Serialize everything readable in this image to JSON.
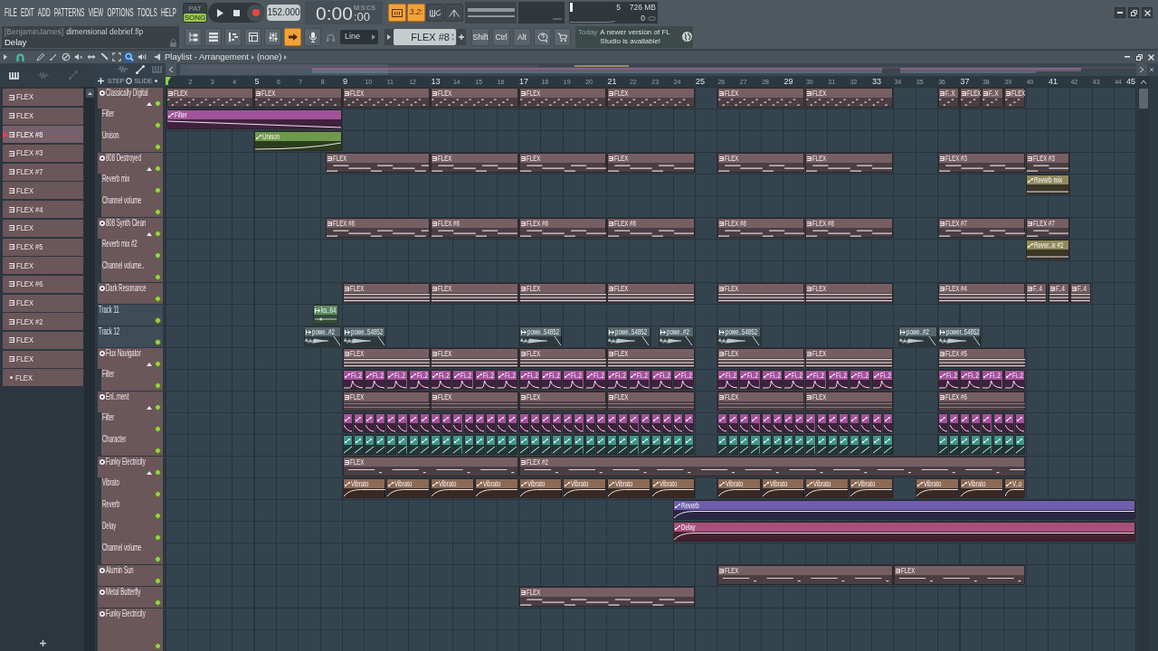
{
  "menu": [
    "FILE",
    "EDIT",
    "ADD",
    "PATTERNS",
    "VIEW",
    "OPTIONS",
    "TOOLS",
    "HELP"
  ],
  "modes": [
    {
      "label": "PAT",
      "selected": false
    },
    {
      "label": "SONG",
      "selected": true
    }
  ],
  "tempo": "152.000",
  "time": {
    "main": "0:00",
    "fraction": ":00",
    "format": "M:S:CS"
  },
  "record_options": [
    {
      "kind": "typing",
      "on": true
    },
    {
      "kind": "countdown",
      "label": "3.2:",
      "on": true
    },
    {
      "kind": "loop",
      "on": false
    },
    {
      "kind": "blend",
      "on": false
    }
  ],
  "performance": {
    "cpu": "5",
    "memory": "726 MB",
    "voices": "0"
  },
  "hint_bar": {
    "user": "[BenjaminJames]",
    "file": "dimensional debrief.flp",
    "hint": "Delay"
  },
  "view_buttons": [
    {
      "kind": "browser",
      "on": false
    },
    {
      "kind": "rack",
      "on": false
    },
    {
      "kind": "piano",
      "on": false
    },
    {
      "kind": "playlist",
      "on": false
    },
    {
      "kind": "mixer",
      "on": false
    },
    {
      "kind": "arrow",
      "on": true
    },
    {
      "kind": "mic",
      "on": false
    }
  ],
  "snap": "Line",
  "pattern": "FLEX #8",
  "modifier_keys": [
    "Shift",
    "Ctrl",
    "Alt"
  ],
  "news": {
    "date": "Today",
    "message": "A newer version of FL Studio is available!"
  },
  "playlist": {
    "title": "Playlist - Arrangement",
    "arrangement": "(none)",
    "tools": [
      {
        "kind": "pencil",
        "selected": false
      },
      {
        "kind": "brush",
        "selected": false
      },
      {
        "kind": "delete",
        "selected": false
      },
      {
        "kind": "mute",
        "selected": false
      },
      {
        "kind": "slip",
        "selected": false
      },
      {
        "kind": "slice",
        "selected": false
      },
      {
        "kind": "select",
        "selected": false
      },
      {
        "kind": "zoom",
        "selected": true
      },
      {
        "kind": "playback",
        "selected": false
      }
    ],
    "picker_tabs": [
      {
        "kind": "pattern",
        "selected": true
      },
      {
        "kind": "audio",
        "selected": false
      },
      {
        "kind": "automation",
        "selected": false
      }
    ],
    "picker": [
      {
        "label": "FLEX",
        "kind": "pattern",
        "selected": false
      },
      {
        "label": "FLEX",
        "kind": "pattern",
        "selected": false
      },
      {
        "label": "FLEX #8",
        "kind": "pattern",
        "selected": true
      },
      {
        "label": "FLEX #3",
        "kind": "pattern",
        "selected": false
      },
      {
        "label": "FLEX #7",
        "kind": "pattern",
        "selected": false
      },
      {
        "label": "FLEX",
        "kind": "pattern",
        "selected": false
      },
      {
        "label": "FLEX #4",
        "kind": "pattern",
        "selected": false
      },
      {
        "label": "FLEX",
        "kind": "pattern",
        "selected": false
      },
      {
        "label": "FLEX #5",
        "kind": "pattern",
        "selected": false
      },
      {
        "label": "FLEX",
        "kind": "pattern",
        "selected": false
      },
      {
        "label": "FLEX #6",
        "kind": "pattern",
        "selected": false
      },
      {
        "label": "FLEX",
        "kind": "pattern",
        "selected": false
      },
      {
        "label": "FLEX #2",
        "kind": "pattern",
        "selected": false
      },
      {
        "label": "FLEX",
        "kind": "pattern",
        "selected": false
      },
      {
        "label": "FLEX",
        "kind": "pattern",
        "selected": false
      },
      {
        "label": "FLEX",
        "kind": "audio",
        "selected": false
      }
    ],
    "lane_options": [
      "STEP",
      "SLIDE"
    ],
    "ruler": [
      "2",
      "3",
      "4",
      "5",
      "6",
      "7",
      "8",
      "9",
      "10",
      "11",
      "12",
      "13",
      "14",
      "15",
      "16",
      "17",
      "18",
      "19",
      "20",
      "21",
      "22",
      "23",
      "24",
      "25",
      "26",
      "27",
      "28",
      "29",
      "30",
      "31",
      "32",
      "33",
      "34",
      "35",
      "36",
      "37",
      "38",
      "39",
      "40",
      "41",
      "42",
      "43",
      "44",
      "45"
    ],
    "tracks": [
      {
        "name": "Classically Digital",
        "kind": "instrument",
        "enabled": true,
        "expanded": true,
        "clips": [
          {
            "label": "FLEX",
            "kind": "pattern"
          },
          {
            "label": "FLEX",
            "kind": "pattern"
          },
          {
            "label": "FLEX",
            "kind": "pattern"
          },
          {
            "label": "FLEX",
            "kind": "pattern"
          },
          {
            "label": "FLEX",
            "kind": "pattern"
          },
          {
            "label": "FLEX",
            "kind": "pattern"
          },
          {
            "label": "FLEX",
            "kind": "pattern"
          },
          {
            "label": "FLEX",
            "kind": "pattern"
          },
          {
            "label": "F..X",
            "kind": "pattern"
          },
          {
            "label": "FLEX",
            "kind": "pattern"
          },
          {
            "label": "F..X",
            "kind": "pattern"
          },
          {
            "label": "FLEX",
            "kind": "pattern"
          }
        ],
        "children": [
          {
            "name": "Filter",
            "enabled": true,
            "clips": [
              {
                "label": "Filter",
                "kind": "automation",
                "color": "#a3529c"
              }
            ]
          },
          {
            "name": "Unison",
            "enabled": true,
            "clips": [
              {
                "label": "Unison",
                "kind": "automation",
                "color": "#6e9a4c"
              }
            ]
          }
        ]
      },
      {
        "name": "808 Destroyed",
        "kind": "instrument",
        "enabled": true,
        "expanded": true,
        "clips": [
          {
            "label": "FLEX",
            "kind": "pattern"
          },
          {
            "label": "FLEX",
            "kind": "pattern"
          },
          {
            "label": "FLEX",
            "kind": "pattern"
          },
          {
            "label": "FLEX",
            "kind": "pattern"
          },
          {
            "label": "FLEX",
            "kind": "pattern"
          },
          {
            "label": "FLEX",
            "kind": "pattern"
          },
          {
            "label": "FLEX #3",
            "kind": "pattern"
          },
          {
            "label": "FLEX #3",
            "kind": "pattern"
          }
        ],
        "children": [
          {
            "name": "Reverb mix",
            "enabled": true,
            "clips": [
              {
                "label": "Reverb mix",
                "kind": "automation",
                "color": "#8f8b5c"
              }
            ]
          },
          {
            "name": "Channel volume",
            "enabled": true
          }
        ]
      },
      {
        "name": "808 Synth Clean",
        "kind": "instrument",
        "enabled": true,
        "expanded": true,
        "clips": [
          {
            "label": "FLEX #8",
            "kind": "pattern"
          },
          {
            "label": "FLEX #8",
            "kind": "pattern"
          },
          {
            "label": "FLEX #8",
            "kind": "pattern"
          },
          {
            "label": "FLEX #8",
            "kind": "pattern"
          },
          {
            "label": "FLEX #8",
            "kind": "pattern"
          },
          {
            "label": "FLEX #8",
            "kind": "pattern"
          },
          {
            "label": "FLEX #7",
            "kind": "pattern"
          },
          {
            "label": "FLEX #7",
            "kind": "pattern"
          }
        ],
        "children": [
          {
            "name": "Reverb mix #2",
            "enabled": true,
            "clips": [
              {
                "label": "Rever..ix #2",
                "kind": "automation",
                "color": "#8f8b5c"
              }
            ]
          },
          {
            "name": "Channel volume..",
            "enabled": true
          }
        ]
      },
      {
        "name": "Dark Resonance",
        "kind": "instrument",
        "enabled": true,
        "clips": [
          {
            "label": "FLEX",
            "kind": "pattern"
          },
          {
            "label": "FLEX",
            "kind": "pattern"
          },
          {
            "label": "FLEX",
            "kind": "pattern"
          },
          {
            "label": "FLEX",
            "kind": "pattern"
          },
          {
            "label": "FLEX",
            "kind": "pattern"
          },
          {
            "label": "FLEX",
            "kind": "pattern"
          },
          {
            "label": "FLEX #4",
            "kind": "pattern"
          },
          {
            "label": "F..4",
            "kind": "pattern"
          },
          {
            "label": "F..4",
            "kind": "pattern"
          },
          {
            "label": "F..4",
            "kind": "pattern"
          }
        ]
      },
      {
        "name": "Track 11",
        "kind": "plain",
        "enabled": true,
        "clips": [
          {
            "label": "ks..64",
            "kind": "audio",
            "color": "#5d8a64"
          }
        ]
      },
      {
        "name": "Track 12",
        "kind": "plain",
        "enabled": true,
        "clips": [
          {
            "label": "powe..#2",
            "kind": "audio",
            "color": "#55676c"
          },
          {
            "label": "powe..54852",
            "kind": "audio",
            "color": "#55676c"
          },
          {
            "label": "powe..54852",
            "kind": "audio",
            "color": "#55676c"
          },
          {
            "label": "powe..54852",
            "kind": "audio",
            "color": "#55676c"
          },
          {
            "label": "powe..#2",
            "kind": "audio",
            "color": "#55676c"
          },
          {
            "label": "powe..54852",
            "kind": "audio",
            "color": "#55676c"
          },
          {
            "label": "powe..#2",
            "kind": "audio",
            "color": "#55676c"
          },
          {
            "label": "power..54852",
            "kind": "audio",
            "color": "#55676c"
          }
        ]
      },
      {
        "name": "Flux Navigator",
        "kind": "instrument",
        "enabled": true,
        "expanded": true,
        "clips": [
          {
            "label": "FLEX",
            "kind": "pattern"
          },
          {
            "label": "FLEX",
            "kind": "pattern"
          },
          {
            "label": "FLEX",
            "kind": "pattern"
          },
          {
            "label": "FLEX",
            "kind": "pattern"
          },
          {
            "label": "FLEX",
            "kind": "pattern"
          },
          {
            "label": "FLEX",
            "kind": "pattern"
          },
          {
            "label": "FLEX #5",
            "kind": "pattern"
          }
        ],
        "children": [
          {
            "name": "Filter",
            "enabled": true,
            "clips": [
              {
                "label": "Fi..2",
                "kind": "automation",
                "color": "#a3529c"
              },
              {
                "label": "Fi..2",
                "kind": "automation",
                "color": "#a3529c"
              },
              {
                "label": "Fi..2",
                "kind": "automation",
                "color": "#a3529c"
              },
              {
                "label": "Fi..2",
                "kind": "automation",
                "color": "#a3529c"
              },
              {
                "label": "Fi..2",
                "kind": "automation",
                "color": "#a3529c"
              },
              {
                "label": "Fi..2",
                "kind": "automation",
                "color": "#a3529c"
              },
              {
                "label": "Fi..2",
                "kind": "automation",
                "color": "#a3529c"
              },
              {
                "label": "Fi..2",
                "kind": "automation",
                "color": "#a3529c"
              },
              {
                "label": "Fi..2",
                "kind": "automation",
                "color": "#a3529c"
              },
              {
                "label": "Fi..2",
                "kind": "automation",
                "color": "#a3529c"
              },
              {
                "label": "Fi..2",
                "kind": "automation",
                "color": "#a3529c"
              },
              {
                "label": "Fi..2",
                "kind": "automation",
                "color": "#a3529c"
              },
              {
                "label": "Fi..2",
                "kind": "automation",
                "color": "#a3529c"
              },
              {
                "label": "Fi..2",
                "kind": "automation",
                "color": "#a3529c"
              },
              {
                "label": "Fi..2",
                "kind": "automation",
                "color": "#a3529c"
              },
              {
                "label": "Fi..2",
                "kind": "automation",
                "color": "#a3529c"
              },
              {
                "label": "Fi..2",
                "kind": "automation",
                "color": "#a3529c"
              },
              {
                "label": "Fi..2",
                "kind": "automation",
                "color": "#a3529c"
              },
              {
                "label": "Fi..2",
                "kind": "automation",
                "color": "#a3529c"
              },
              {
                "label": "Fi..2",
                "kind": "automation",
                "color": "#a3529c"
              },
              {
                "label": "Fi..2",
                "kind": "automation",
                "color": "#a3529c"
              },
              {
                "label": "Fi..2",
                "kind": "automation",
                "color": "#a3529c"
              },
              {
                "label": "Fi..2",
                "kind": "automation",
                "color": "#a3529c"
              },
              {
                "label": "Fi..2",
                "kind": "automation",
                "color": "#a3529c"
              },
              {
                "label": "Fi..2",
                "kind": "automation",
                "color": "#a3529c"
              },
              {
                "label": "Fi..2",
                "kind": "automation",
                "color": "#a3529c"
              },
              {
                "label": "Fi..2",
                "kind": "automation",
                "color": "#a3529c"
              },
              {
                "label": "Fi..2",
                "kind": "automation",
                "color": "#a3529c"
              }
            ]
          }
        ]
      },
      {
        "name": "Enl..ment",
        "kind": "instrument",
        "enabled": true,
        "expanded": true,
        "clips": [
          {
            "label": "FLEX",
            "kind": "pattern"
          },
          {
            "label": "FLEX",
            "kind": "pattern"
          },
          {
            "label": "FLEX",
            "kind": "pattern"
          },
          {
            "label": "FLEX",
            "kind": "pattern"
          },
          {
            "label": "FLEX",
            "kind": "pattern"
          },
          {
            "label": "FLEX",
            "kind": "pattern"
          },
          {
            "label": "FLEX #6",
            "kind": "pattern"
          }
        ],
        "children": [
          {
            "name": "Filter",
            "enabled": true,
            "clips": [
              {
                "kind": "automation",
                "color": "#a3529c"
              },
              {
                "kind": "automation",
                "color": "#a3529c"
              },
              {
                "kind": "automation",
                "color": "#a3529c"
              },
              {
                "kind": "automation",
                "color": "#a3529c"
              },
              {
                "kind": "automation",
                "color": "#a3529c"
              },
              {
                "kind": "automation",
                "color": "#a3529c"
              },
              {
                "kind": "automation",
                "color": "#a3529c"
              },
              {
                "kind": "automation",
                "color": "#a3529c"
              },
              {
                "kind": "automation",
                "color": "#a3529c"
              },
              {
                "kind": "automation",
                "color": "#a3529c"
              },
              {
                "kind": "automation",
                "color": "#a3529c"
              },
              {
                "kind": "automation",
                "color": "#a3529c"
              },
              {
                "kind": "automation",
                "color": "#a3529c"
              },
              {
                "kind": "automation",
                "color": "#a3529c"
              },
              {
                "kind": "automation",
                "color": "#a3529c"
              },
              {
                "kind": "automation",
                "color": "#a3529c"
              },
              {
                "kind": "automation",
                "color": "#a3529c"
              },
              {
                "kind": "automation",
                "color": "#a3529c"
              },
              {
                "kind": "automation",
                "color": "#a3529c"
              },
              {
                "kind": "automation",
                "color": "#a3529c"
              },
              {
                "kind": "automation",
                "color": "#a3529c"
              },
              {
                "kind": "automation",
                "color": "#a3529c"
              },
              {
                "kind": "automation",
                "color": "#a3529c"
              },
              {
                "kind": "automation",
                "color": "#a3529c"
              },
              {
                "kind": "automation",
                "color": "#a3529c"
              },
              {
                "kind": "automation",
                "color": "#a3529c"
              },
              {
                "kind": "automation",
                "color": "#a3529c"
              },
              {
                "kind": "automation",
                "color": "#a3529c"
              },
              {
                "kind": "automation",
                "color": "#a3529c"
              },
              {
                "kind": "automation",
                "color": "#a3529c"
              },
              {
                "kind": "automation",
                "color": "#a3529c"
              },
              {
                "kind": "automation",
                "color": "#a3529c"
              },
              {
                "kind": "automation",
                "color": "#a3529c"
              },
              {
                "kind": "automation",
                "color": "#a3529c"
              },
              {
                "kind": "automation",
                "color": "#a3529c"
              },
              {
                "kind": "automation",
                "color": "#a3529c"
              },
              {
                "kind": "automation",
                "color": "#a3529c"
              },
              {
                "kind": "automation",
                "color": "#a3529c"
              },
              {
                "kind": "automation",
                "color": "#a3529c"
              },
              {
                "kind": "automation",
                "color": "#a3529c"
              },
              {
                "kind": "automation",
                "color": "#a3529c"
              },
              {
                "kind": "automation",
                "color": "#a3529c"
              },
              {
                "kind": "automation",
                "color": "#a3529c"
              },
              {
                "kind": "automation",
                "color": "#a3529c"
              },
              {
                "kind": "automation",
                "color": "#a3529c"
              },
              {
                "kind": "automation",
                "color": "#a3529c"
              },
              {
                "kind": "automation",
                "color": "#a3529c"
              },
              {
                "kind": "automation",
                "color": "#a3529c"
              },
              {
                "kind": "automation",
                "color": "#a3529c"
              },
              {
                "kind": "automation",
                "color": "#a3529c"
              },
              {
                "kind": "automation",
                "color": "#a3529c"
              },
              {
                "kind": "automation",
                "color": "#a3529c"
              },
              {
                "kind": "automation",
                "color": "#a3529c"
              },
              {
                "kind": "automation",
                "color": "#a3529c"
              },
              {
                "kind": "automation",
                "color": "#a3529c"
              },
              {
                "kind": "automation",
                "color": "#a3529c"
              }
            ]
          },
          {
            "name": "Character",
            "enabled": true,
            "clips": [
              {
                "kind": "automation",
                "color": "#3f958a"
              },
              {
                "kind": "automation",
                "color": "#3f958a"
              },
              {
                "kind": "automation",
                "color": "#3f958a"
              },
              {
                "kind": "automation",
                "color": "#3f958a"
              },
              {
                "kind": "automation",
                "color": "#3f958a"
              },
              {
                "kind": "automation",
                "color": "#3f958a"
              },
              {
                "kind": "automation",
                "color": "#3f958a"
              },
              {
                "kind": "automation",
                "color": "#3f958a"
              },
              {
                "kind": "automation",
                "color": "#3f958a"
              },
              {
                "kind": "automation",
                "color": "#3f958a"
              },
              {
                "kind": "automation",
                "color": "#3f958a"
              },
              {
                "kind": "automation",
                "color": "#3f958a"
              },
              {
                "kind": "automation",
                "color": "#3f958a"
              },
              {
                "kind": "automation",
                "color": "#3f958a"
              },
              {
                "kind": "automation",
                "color": "#3f958a"
              },
              {
                "kind": "automation",
                "color": "#3f958a"
              },
              {
                "kind": "automation",
                "color": "#3f958a"
              },
              {
                "kind": "automation",
                "color": "#3f958a"
              },
              {
                "kind": "automation",
                "color": "#3f958a"
              },
              {
                "kind": "automation",
                "color": "#3f958a"
              },
              {
                "kind": "automation",
                "color": "#3f958a"
              },
              {
                "kind": "automation",
                "color": "#3f958a"
              },
              {
                "kind": "automation",
                "color": "#3f958a"
              },
              {
                "kind": "automation",
                "color": "#3f958a"
              },
              {
                "kind": "automation",
                "color": "#3f958a"
              },
              {
                "kind": "automation",
                "color": "#3f958a"
              },
              {
                "kind": "automation",
                "color": "#3f958a"
              },
              {
                "kind": "automation",
                "color": "#3f958a"
              },
              {
                "kind": "automation",
                "color": "#3f958a"
              },
              {
                "kind": "automation",
                "color": "#3f958a"
              },
              {
                "kind": "automation",
                "color": "#3f958a"
              },
              {
                "kind": "automation",
                "color": "#3f958a"
              },
              {
                "kind": "automation",
                "color": "#3f958a"
              },
              {
                "kind": "automation",
                "color": "#3f958a"
              },
              {
                "kind": "automation",
                "color": "#3f958a"
              },
              {
                "kind": "automation",
                "color": "#3f958a"
              },
              {
                "kind": "automation",
                "color": "#3f958a"
              },
              {
                "kind": "automation",
                "color": "#3f958a"
              },
              {
                "kind": "automation",
                "color": "#3f958a"
              },
              {
                "kind": "automation",
                "color": "#3f958a"
              },
              {
                "kind": "automation",
                "color": "#3f958a"
              },
              {
                "kind": "automation",
                "color": "#3f958a"
              },
              {
                "kind": "automation",
                "color": "#3f958a"
              },
              {
                "kind": "automation",
                "color": "#3f958a"
              },
              {
                "kind": "automation",
                "color": "#3f958a"
              },
              {
                "kind": "automation",
                "color": "#3f958a"
              },
              {
                "kind": "automation",
                "color": "#3f958a"
              },
              {
                "kind": "automation",
                "color": "#3f958a"
              },
              {
                "kind": "automation",
                "color": "#3f958a"
              },
              {
                "kind": "automation",
                "color": "#3f958a"
              },
              {
                "kind": "automation",
                "color": "#3f958a"
              },
              {
                "kind": "automation",
                "color": "#3f958a"
              },
              {
                "kind": "automation",
                "color": "#3f958a"
              },
              {
                "kind": "automation",
                "color": "#3f958a"
              },
              {
                "kind": "automation",
                "color": "#3f958a"
              },
              {
                "kind": "automation",
                "color": "#3f958a"
              }
            ]
          }
        ]
      },
      {
        "name": "Funky Electricity",
        "kind": "instrument",
        "enabled": true,
        "expanded": true,
        "clips": [
          {
            "label": "FLEX",
            "kind": "pattern"
          },
          {
            "label": "FLEX #2",
            "kind": "pattern"
          }
        ],
        "children": [
          {
            "name": "Vibrato",
            "enabled": true,
            "clips": [
              {
                "label": "Vibrato",
                "kind": "automation",
                "color": "#8c6a55"
              },
              {
                "label": "Vibrato",
                "kind": "automation",
                "color": "#8c6a55"
              },
              {
                "label": "Vibrato",
                "kind": "automation",
                "color": "#8c6a55"
              },
              {
                "label": "Vibrato",
                "kind": "automation",
                "color": "#8c6a55"
              },
              {
                "label": "Vibrato",
                "kind": "automation",
                "color": "#8c6a55"
              },
              {
                "label": "Vibrato",
                "kind": "automation",
                "color": "#8c6a55"
              },
              {
                "label": "Vibrato",
                "kind": "automation",
                "color": "#8c6a55"
              },
              {
                "label": "Vibrato",
                "kind": "automation",
                "color": "#8c6a55"
              },
              {
                "label": "Vibrato",
                "kind": "automation",
                "color": "#8c6a55"
              },
              {
                "label": "Vibrato",
                "kind": "automation",
                "color": "#8c6a55"
              },
              {
                "label": "Vibrato",
                "kind": "automation",
                "color": "#8c6a55"
              },
              {
                "label": "Vibrato",
                "kind": "automation",
                "color": "#8c6a55"
              },
              {
                "label": "Vibrato",
                "kind": "automation",
                "color": "#8c6a55"
              },
              {
                "label": "Vibrato",
                "kind": "automation",
                "color": "#8c6a55"
              },
              {
                "label": "V..o",
                "kind": "automation",
                "color": "#8c6a55"
              }
            ]
          },
          {
            "name": "Reverb",
            "enabled": true,
            "clips": [
              {
                "label": "Reverb",
                "kind": "automation",
                "color": "#6e5fae"
              }
            ]
          },
          {
            "name": "Delay",
            "enabled": true,
            "clips": [
              {
                "label": "Delay",
                "kind": "automation",
                "color": "#a8507c"
              }
            ]
          },
          {
            "name": "Channel volume",
            "enabled": true
          }
        ]
      },
      {
        "name": "Alumin Sun",
        "kind": "instrument",
        "enabled": true,
        "clips": [
          {
            "label": "FLEX",
            "kind": "pattern"
          },
          {
            "label": "FLEX",
            "kind": "pattern"
          }
        ]
      },
      {
        "name": "Metal Butterfly",
        "kind": "instrument",
        "enabled": true,
        "clips": [
          {
            "label": "FLEX",
            "kind": "pattern"
          }
        ]
      },
      {
        "name": "Funky Electricity",
        "kind": "instrument",
        "enabled": true
      }
    ]
  }
}
